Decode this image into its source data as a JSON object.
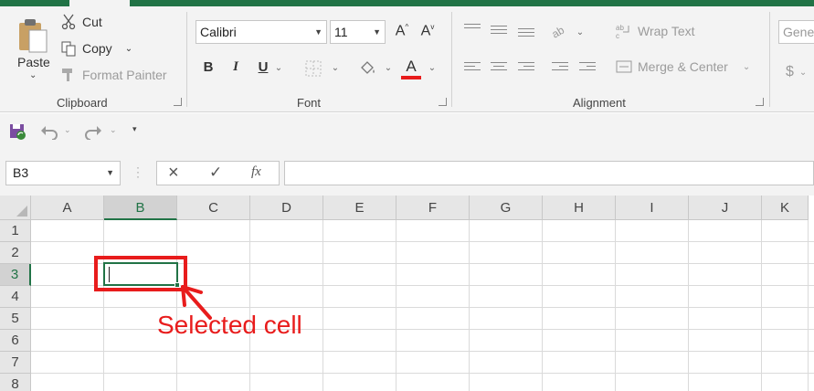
{
  "ribbon": {
    "clipboard": {
      "paste_label": "Paste",
      "cut_label": "Cut",
      "copy_label": "Copy",
      "format_painter_label": "Format Painter",
      "group_label": "Clipboard"
    },
    "font": {
      "font_name": "Calibri",
      "font_size": "11",
      "bold_label": "B",
      "italic_label": "I",
      "underline_label": "U",
      "grow_font_label": "A",
      "shrink_font_label": "A",
      "font_color_label": "A",
      "font_color": "#e81c1c",
      "group_label": "Font"
    },
    "alignment": {
      "wrap_text_label": "Wrap Text",
      "merge_center_label": "Merge & Center",
      "group_label": "Alignment"
    },
    "number": {
      "format_value": "Gener",
      "currency_label": "$"
    }
  },
  "formula_bar": {
    "name_box": "B3",
    "cancel_icon": "×",
    "enter_icon": "✓",
    "fx_label": "fx",
    "formula": ""
  },
  "sheet": {
    "columns": [
      "A",
      "B",
      "C",
      "D",
      "E",
      "F",
      "G",
      "H",
      "I",
      "J",
      "K"
    ],
    "rows": [
      "1",
      "2",
      "3",
      "4",
      "5",
      "6",
      "7",
      "8"
    ],
    "selected_column": "B",
    "selected_row": "3"
  },
  "annotation": {
    "text": "Selected cell",
    "color": "#e81c1c"
  },
  "theme": {
    "accent": "#217346"
  }
}
